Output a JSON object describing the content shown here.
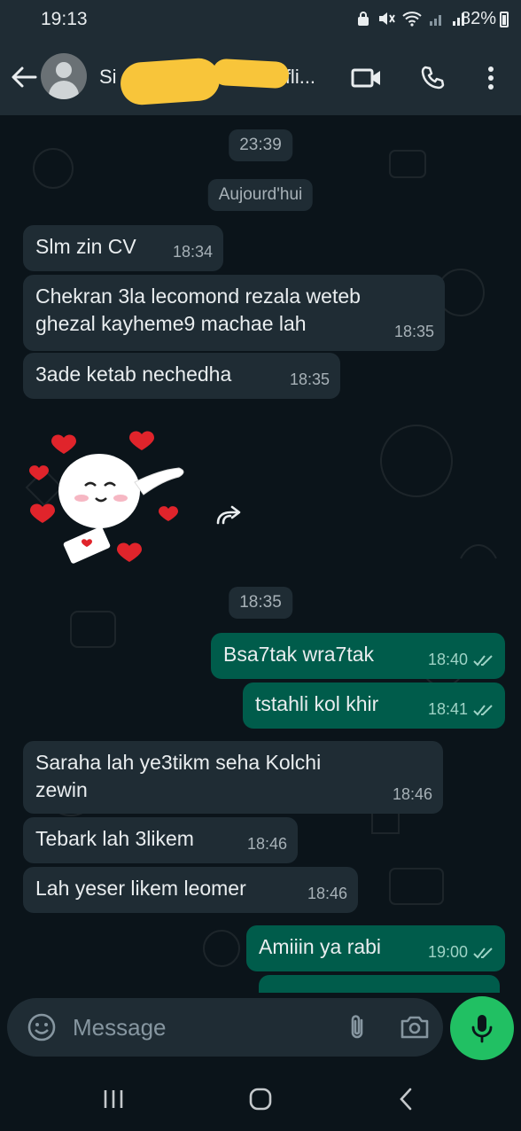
{
  "status_bar": {
    "time": "19:13",
    "battery": "82%"
  },
  "header": {
    "contact_name_start": "Si",
    "contact_name_end": "fli..."
  },
  "messages": [
    {
      "kind": "system",
      "text": "23:39"
    },
    {
      "kind": "system",
      "text": "Aujourd'hui"
    },
    {
      "kind": "in",
      "text": "Slm zin CV",
      "time": "18:34"
    },
    {
      "kind": "in",
      "text": "Chekran 3la lecomond rezala weteb ghezal kayheme9 machae lah",
      "time": "18:35"
    },
    {
      "kind": "in",
      "text": "3ade ketab nechedha",
      "time": "18:35"
    },
    {
      "kind": "sticker",
      "icon": "heart-sticker-icon"
    },
    {
      "kind": "system",
      "text": "18:35"
    },
    {
      "kind": "out",
      "text": "Bsa7tak wra7tak",
      "time": "18:40",
      "status": "read"
    },
    {
      "kind": "out",
      "text": "tstahli kol khir",
      "time": "18:41",
      "status": "read"
    },
    {
      "kind": "in",
      "text": "Saraha lah ye3tikm seha Kolchi zewin",
      "time": "18:46"
    },
    {
      "kind": "in",
      "text": "Tebark lah 3likem",
      "time": "18:46"
    },
    {
      "kind": "in",
      "text": "Lah yeser likem leomer",
      "time": "18:46"
    },
    {
      "kind": "out",
      "text": "Amiiin ya rabi",
      "time": "19:00",
      "status": "read"
    }
  ],
  "composer": {
    "placeholder": "Message"
  },
  "colors": {
    "background": "#0b141a",
    "incoming_bubble": "#1f2c34",
    "outgoing_bubble": "#005c4b",
    "mic_button": "#21c063",
    "redaction": "#f8c53a"
  }
}
